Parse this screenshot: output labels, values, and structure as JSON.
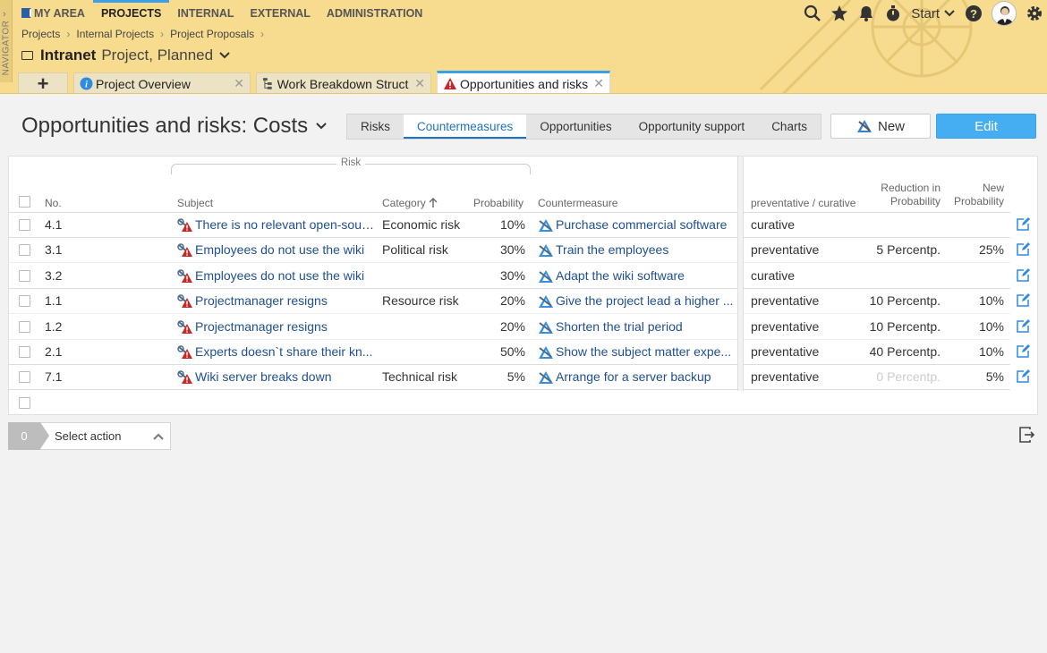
{
  "navigator": {
    "label": "NAVIGATOR"
  },
  "menu": {
    "items": [
      "MY AREA",
      "PROJECTS",
      "INTERNAL",
      "EXTERNAL",
      "ADMINISTRATION"
    ]
  },
  "toolbar": {
    "start_label": "Start"
  },
  "breadcrumb": [
    "Projects",
    "Internal Projects",
    "Project Proposals"
  ],
  "project": {
    "name": "Intranet",
    "status": "Project, Planned"
  },
  "tabs": [
    {
      "label": "Project Overview"
    },
    {
      "label": "Work Breakdown Structure"
    },
    {
      "label": "Opportunities and risks"
    }
  ],
  "page": {
    "title": "Opportunities and risks: Costs"
  },
  "view_tabs": [
    "Risks",
    "Countermeasures",
    "Opportunities",
    "Opportunity support",
    "Charts"
  ],
  "actions": {
    "new_label": "New",
    "edit_label": "Edit"
  },
  "table": {
    "group_label": "Risk",
    "headers": {
      "no": "No.",
      "subject": "Subject",
      "category": "Category",
      "probability": "Probability",
      "countermeasure": "Countermeasure",
      "prev_cur": "preventative / curative",
      "reduction": "Reduction in Probability",
      "new_prob": "New Probability"
    },
    "rows": [
      {
        "no": "4.1",
        "subject": "There is no relevant open-source...",
        "category": "Economic risk",
        "probability": "10%",
        "countermeasure": "Purchase commercial software",
        "type": "curative",
        "reduction": "",
        "new_prob": ""
      },
      {
        "no": "3.1",
        "subject": "Employees do not use the wiki",
        "category": "Political risk",
        "probability": "30%",
        "countermeasure": "Train the employees",
        "type": "preventative",
        "reduction": "5 Percentp.",
        "new_prob": "25%"
      },
      {
        "no": "3.2",
        "subject": "Employees do not use the wiki",
        "category": "",
        "probability": "30%",
        "countermeasure": "Adapt the wiki software",
        "type": "curative",
        "reduction": "",
        "new_prob": ""
      },
      {
        "no": "1.1",
        "subject": "Projectmanager resigns",
        "category": "Resource risk",
        "probability": "20%",
        "countermeasure": "Give the project lead a higher ...",
        "type": "preventative",
        "reduction": "10 Percentp.",
        "new_prob": "10%"
      },
      {
        "no": "1.2",
        "subject": "Projectmanager resigns",
        "category": "",
        "probability": "20%",
        "countermeasure": "Shorten the trial period",
        "type": "preventative",
        "reduction": "10 Percentp.",
        "new_prob": "10%"
      },
      {
        "no": "2.1",
        "subject": "Experts doesn`t share their kn...",
        "category": "",
        "probability": "50%",
        "countermeasure": "Show the subject matter expe...",
        "type": "preventative",
        "reduction": "40 Percentp.",
        "new_prob": "10%"
      },
      {
        "no": "7.1",
        "subject": "Wiki server breaks down",
        "category": "Technical risk",
        "probability": "5%",
        "countermeasure": "Arrange for a server backup",
        "type": "preventative",
        "reduction": "0  Percentp.",
        "new_prob": "5%"
      }
    ]
  },
  "footer": {
    "count": "0",
    "select_action": "Select action"
  }
}
